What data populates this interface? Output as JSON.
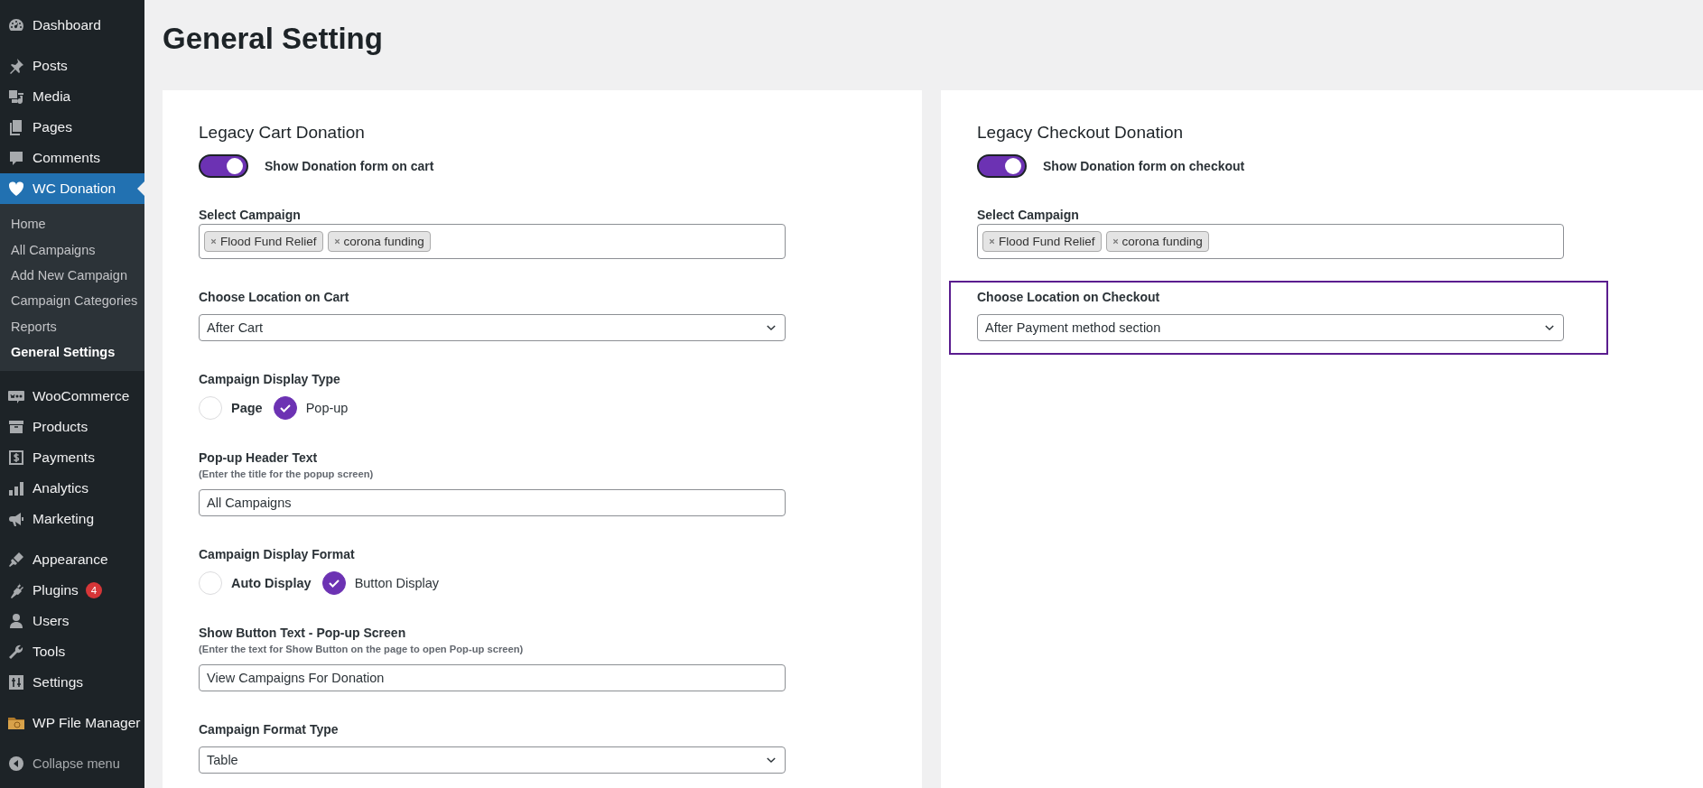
{
  "page_title": "General Setting",
  "sidebar": {
    "groups": [
      {
        "items": [
          {
            "label": "Dashboard",
            "selected": false
          }
        ]
      },
      {
        "items": [
          {
            "label": "Posts",
            "selected": false
          },
          {
            "label": "Media",
            "selected": false
          },
          {
            "label": "Pages",
            "selected": false
          },
          {
            "label": "Comments",
            "selected": false
          },
          {
            "label": "WC Donation",
            "selected": true,
            "submenu": [
              {
                "label": "Home",
                "selected": false
              },
              {
                "label": "All Campaigns",
                "selected": false
              },
              {
                "label": "Add New Campaign",
                "selected": false
              },
              {
                "label": "Campaign Categories",
                "selected": false
              },
              {
                "label": "Reports",
                "selected": false
              },
              {
                "label": "General Settings",
                "selected": true
              }
            ]
          }
        ]
      },
      {
        "items": [
          {
            "label": "WooCommerce",
            "selected": false
          },
          {
            "label": "Products",
            "selected": false
          },
          {
            "label": "Payments",
            "selected": false
          },
          {
            "label": "Analytics",
            "selected": false
          },
          {
            "label": "Marketing",
            "selected": false
          }
        ]
      },
      {
        "items": [
          {
            "label": "Appearance",
            "selected": false
          },
          {
            "label": "Plugins",
            "selected": false,
            "badge": "4"
          },
          {
            "label": "Users",
            "selected": false
          },
          {
            "label": "Tools",
            "selected": false
          },
          {
            "label": "Settings",
            "selected": false
          }
        ]
      },
      {
        "items": [
          {
            "label": "WP File Manager",
            "selected": false
          }
        ]
      }
    ],
    "collapse_label": "Collapse menu"
  },
  "cards": [
    {
      "title": "Legacy Cart Donation",
      "toggle": {
        "label": "Show Donation form on cart",
        "on": true
      },
      "fields": [
        {
          "kind": "tags",
          "label": "Select Campaign",
          "tags": [
            "Flood Fund Relief",
            "corona funding"
          ]
        },
        {
          "kind": "select",
          "label": "Choose Location on Cart",
          "value": "After Cart",
          "highlighted": false
        },
        {
          "kind": "radio",
          "label": "Campaign Display Type",
          "options": [
            {
              "label": "Page",
              "selected": false
            },
            {
              "label": "Pop-up",
              "selected": true
            }
          ]
        },
        {
          "kind": "text",
          "label": "Pop-up Header Text",
          "hint": "(Enter the title for the popup screen)",
          "value": "All Campaigns"
        },
        {
          "kind": "radio",
          "label": "Campaign Display Format",
          "options": [
            {
              "label": "Auto Display",
              "selected": false
            },
            {
              "label": "Button Display",
              "selected": true
            }
          ]
        },
        {
          "kind": "text",
          "label": "Show Button Text - Pop-up Screen",
          "hint": "(Enter the text for Show Button on the page to open Pop-up screen)",
          "value": "View Campaigns For Donation"
        },
        {
          "kind": "select",
          "label": "Campaign Format Type",
          "value": "Table",
          "highlighted": false
        }
      ]
    },
    {
      "title": "Legacy Checkout Donation",
      "toggle": {
        "label": "Show Donation form on checkout",
        "on": true
      },
      "fields": [
        {
          "kind": "tags",
          "label": "Select Campaign",
          "tags": [
            "Flood Fund Relief",
            "corona funding"
          ]
        },
        {
          "kind": "select",
          "label": "Choose Location on Checkout",
          "value": "After Payment method section",
          "highlighted": true
        }
      ]
    }
  ]
}
